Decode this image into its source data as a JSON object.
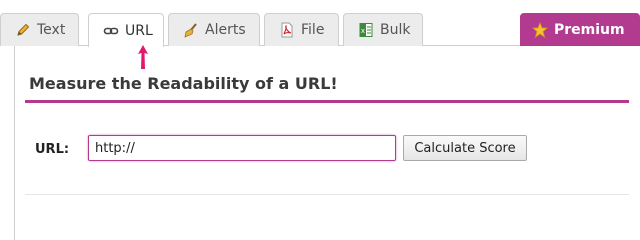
{
  "tabs": [
    {
      "label": "Text",
      "icon": "pencil-icon"
    },
    {
      "label": "URL",
      "icon": "link-icon"
    },
    {
      "label": "Alerts",
      "icon": "broom-icon"
    },
    {
      "label": "File",
      "icon": "pdf-file-icon"
    },
    {
      "label": "Bulk",
      "icon": "spreadsheet-icon"
    }
  ],
  "active_tab": "URL",
  "premium": {
    "label": "Premium",
    "icon": "star-icon"
  },
  "panel": {
    "heading": "Measure the Readability of a URL!",
    "url_label": "URL:",
    "url_value": "http://",
    "button_label": "Calculate Score"
  },
  "colors": {
    "accent": "#b33b8f",
    "arrow": "#e0196e"
  }
}
